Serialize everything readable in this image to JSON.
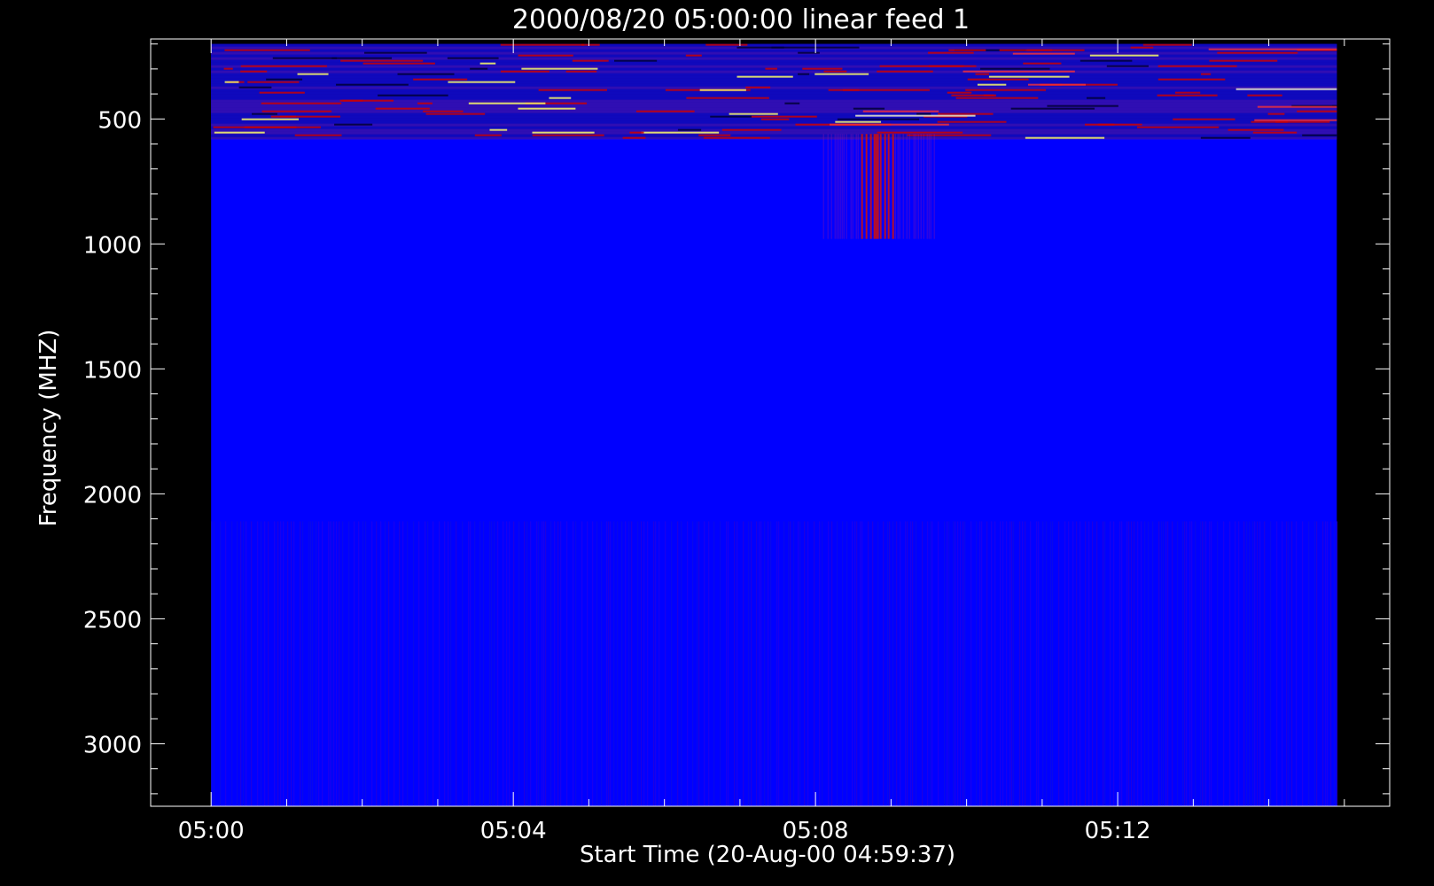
{
  "chart_data": {
    "type": "heatmap",
    "title": "2000/08/20 05:00:00 linear feed 1",
    "xlabel": "Start Time (20-Aug-00 04:59:37)",
    "ylabel": "Frequency (MHZ)",
    "x_ticks": [
      "05:00",
      "05:04",
      "05:08",
      "05:12"
    ],
    "y_ticks": [
      500,
      1000,
      1500,
      2000,
      2500,
      3000
    ],
    "xlim_minutes_after_0500": [
      -0.8,
      15.6
    ],
    "x_data_extent_minutes_after_0500": [
      0,
      14.9
    ],
    "ylim_mhz": [
      180,
      3250
    ],
    "y_data_extent_mhz": [
      200,
      3250
    ],
    "y_reversed": true,
    "colors": {
      "background": "#000000",
      "axes": "#ffffff",
      "low": "#0000ff",
      "mid": "#cc0000",
      "high": "#ffff66",
      "dark": "#000033"
    },
    "features": [
      {
        "label": "high-activity band",
        "t_start": 0.0,
        "t_end": 14.9,
        "f_low": 200,
        "f_high": 580
      },
      {
        "label": "burst",
        "t_start": 8.1,
        "t_end": 9.6,
        "f_low": 560,
        "f_high": 980
      },
      {
        "label": "striped region",
        "t_start": 0.0,
        "t_end": 14.9,
        "f_low": 2110,
        "f_high": 3250
      }
    ]
  }
}
